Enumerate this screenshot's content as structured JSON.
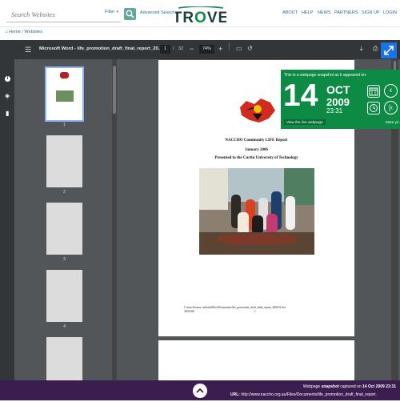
{
  "header": {
    "search_placeholder": "Search Websites",
    "filter_label": "Filter",
    "advanced_search_label": "Advanced Search",
    "logo_text": "TROVE",
    "nav": [
      "ABOUT",
      "HELP",
      "NEWS",
      "PARTNERS",
      "SIGN UP",
      "LOGIN"
    ]
  },
  "breadcrumb": {
    "home": "Home",
    "separator": "/",
    "current": "Websites"
  },
  "pdf": {
    "title": "Microsoft Word - life_promotion_draft_final_report_20...",
    "page_current": "1",
    "page_sep": "/",
    "page_total": "32",
    "zoom": "74%",
    "thumb_numbers": [
      "1",
      "2",
      "3",
      "4"
    ],
    "doc_title": "NACCHO Community LIFE Report",
    "doc_date": "January 2006",
    "doc_presented": "Presented to the Curtin University of Technology",
    "doc_footer_path": "C:\\naccho\\new website\\Files\\Documents\\life_promotion_draft_final_report_260103.doc",
    "doc_footer_ts": "30/01/06",
    "doc_footer_page": "1"
  },
  "snapshot_panel": {
    "caption": "This is a webpage snapshot as it appeared on:",
    "day": "14",
    "month": "OCT",
    "year": "2009",
    "time": "23:31",
    "live_link": "View the live webpage",
    "more_link": "More yo"
  },
  "footer": {
    "prefix": "Webpage",
    "bold1": "snapshot",
    "mid": "captured on",
    "bold2": "14 Oct 2009 23:31",
    "url_label": "URL:",
    "url": "http://www.naccho.org.au/Files/Documents/life_promotion_draft_final_report."
  },
  "colors": {
    "trove_green": "#0d8a44",
    "footer_purple": "#3c1d4f",
    "link_blue": "#2c6b8f",
    "pdf_toolbar": "#323639"
  }
}
